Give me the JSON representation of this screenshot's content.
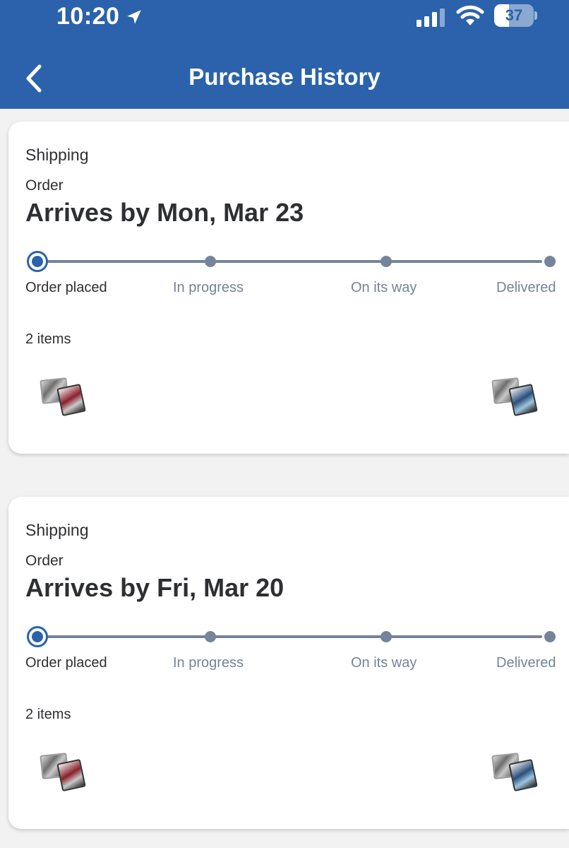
{
  "status_bar": {
    "time": "10:20",
    "battery": "37",
    "battery_level": 0.37
  },
  "header": {
    "title": "Purchase History"
  },
  "steps": [
    "Order placed",
    "In progress",
    "On its way",
    "Delivered"
  ],
  "orders": [
    {
      "type": "Shipping",
      "order_label": "Order",
      "arrival": "Arrives by Mon, Mar 23",
      "current_step": 0,
      "items_count": "2 items"
    },
    {
      "type": "Shipping",
      "order_label": "Order",
      "arrival": "Arrives by Fri, Mar 20",
      "current_step": 0,
      "items_count": "2 items"
    }
  ],
  "colors": {
    "brand_blue": "#2b62ab",
    "track_gray": "#74849a",
    "text_dark": "#2e2f32"
  }
}
